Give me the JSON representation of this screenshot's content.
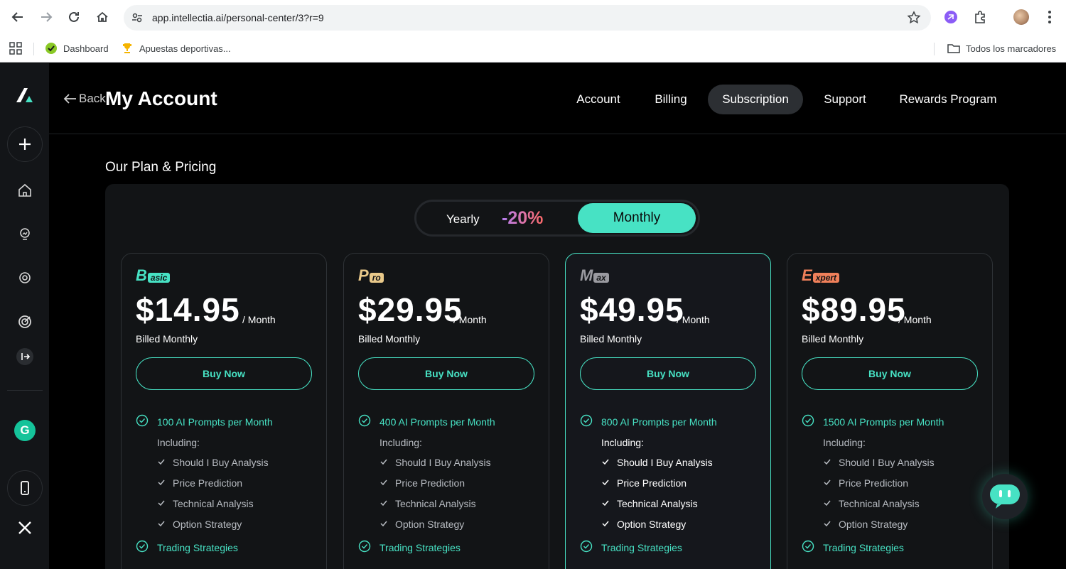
{
  "browser": {
    "url": "app.intellectia.ai/personal-center/3?r=9",
    "bookmarks": [
      {
        "label": "Dashboard"
      },
      {
        "label": "Apuestas deportivas..."
      }
    ],
    "all_bookmarks": "Todos los marcadores"
  },
  "header": {
    "back_label": "Back",
    "title": "My Account",
    "nav": [
      "Account",
      "Billing",
      "Subscription",
      "Support",
      "Rewards Program"
    ],
    "active_nav": "Subscription"
  },
  "pricing": {
    "section_title": "Our Plan & Pricing",
    "toggle": {
      "yearly": "Yearly",
      "discount": "-20%",
      "monthly": "Monthly",
      "selected": "Monthly"
    },
    "plans": [
      {
        "badge_big": "B",
        "badge_small": "asic",
        "badge_color": "#47e2c4",
        "price": "$14.95",
        "per": "/ Month",
        "billed": "Billed Monthly",
        "buy": "Buy Now",
        "prompts": "100 AI Prompts per Month",
        "including": "Including:",
        "items": [
          "Should I Buy Analysis",
          "Price Prediction",
          "Technical Analysis",
          "Option Strategy"
        ],
        "extra": "Trading Strategies"
      },
      {
        "badge_big": "P",
        "badge_small": "ro",
        "badge_color": "#e9c98a",
        "price": "$29.95",
        "per": "/ Month",
        "billed": "Billed Monthly",
        "buy": "Buy Now",
        "prompts": "400 AI Prompts per Month",
        "including": "Including:",
        "items": [
          "Should I Buy Analysis",
          "Price Prediction",
          "Technical Analysis",
          "Option Strategy"
        ],
        "extra": "Trading Strategies"
      },
      {
        "badge_big": "M",
        "badge_small": "ax",
        "badge_color": "#9a9aa0",
        "price": "$49.95",
        "per": "/ Month",
        "billed": "Billed Monthly",
        "buy": "Buy Now",
        "prompts": "800 AI Prompts per Month",
        "including": "Including:",
        "items": [
          "Should I Buy Analysis",
          "Price Prediction",
          "Technical Analysis",
          "Option Strategy"
        ],
        "extra": "Trading Strategies"
      },
      {
        "badge_big": "E",
        "badge_small": "xpert",
        "badge_color": "#f0805a",
        "price": "$89.95",
        "per": "/ Month",
        "billed": "Billed Monthly",
        "buy": "Buy Now",
        "prompts": "1500 AI Prompts per Month",
        "including": "Including:",
        "items": [
          "Should I Buy Analysis",
          "Price Prediction",
          "Technical Analysis",
          "Option Strategy"
        ],
        "extra": "Trading Strategies"
      }
    ]
  },
  "sidebar": {
    "items": [
      "logo-icon",
      "add-icon",
      "home-icon",
      "idea-icon",
      "target-icon",
      "radar-icon",
      "expand-icon",
      "grammarly-icon",
      "mobile-icon",
      "x-icon"
    ],
    "grammarly_letter": "G"
  },
  "colors": {
    "accent": "#47e2c4",
    "panel": "#121416",
    "sidebar": "#131518"
  }
}
